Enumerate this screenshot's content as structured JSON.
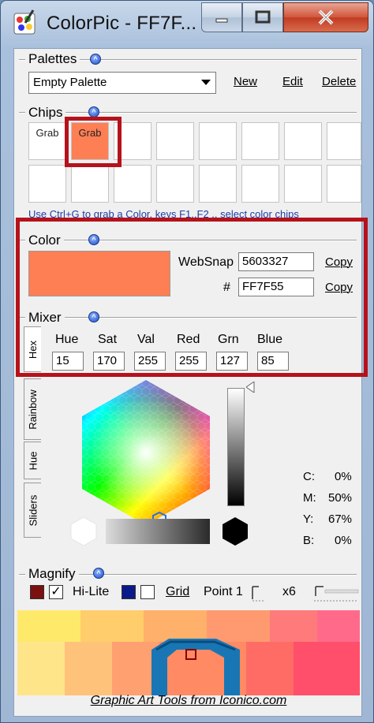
{
  "window": {
    "title": "ColorPic - FF7F...",
    "minimize_icon": "minimize-icon",
    "maximize_icon": "maximize-icon",
    "close_icon": "close-icon"
  },
  "palettes": {
    "label": "Palettes",
    "selected": "Empty Palette",
    "new_label": "New",
    "edit_label": "Edit",
    "delete_label": "Delete"
  },
  "chips": {
    "label": "Chips",
    "chip1_label": "Grab",
    "chip2_label": "Grab",
    "chip2_color": "#ff7f55",
    "hint": "Use Ctrl+G to grab a Color, keys F1..F2 .. select color chips"
  },
  "color": {
    "label": "Color",
    "current_hex": "#ff7f55",
    "websnap_label": "WebSnap",
    "websnap_value": "5603327",
    "hash_label": "#",
    "hex_value": "FF7F55",
    "copy_label_1": "Copy",
    "copy_label_2": "Copy"
  },
  "mixer": {
    "label": "Mixer",
    "hue_label": "Hue",
    "hue": "15",
    "sat_label": "Sat",
    "sat": "170",
    "val_label": "Val",
    "val": "255",
    "red_label": "Red",
    "red": "255",
    "grn_label": "Grn",
    "grn": "127",
    "blue_label": "Blue",
    "blue": "85",
    "tabs": [
      "Hex",
      "Rainbow",
      "Hue",
      "Sliders"
    ],
    "cmyk": {
      "c_label": "C:",
      "c": "0%",
      "m_label": "M:",
      "m": "50%",
      "y_label": "Y:",
      "y": "67%",
      "b_label": "B:",
      "b": "0%"
    }
  },
  "magnify": {
    "label": "Magnify",
    "hilite_label": "Hi-Lite",
    "hilite_color": "#7a1010",
    "grid_label": "Grid",
    "grid_color": "#0b1a8a",
    "point_label": "Point 1",
    "zoom_label": "x6"
  },
  "footer": {
    "link": "Graphic Art Tools from Iconico.com"
  },
  "colors": {
    "highlight_red": "#b5121b",
    "accent_blue": "#1e4fc9"
  }
}
